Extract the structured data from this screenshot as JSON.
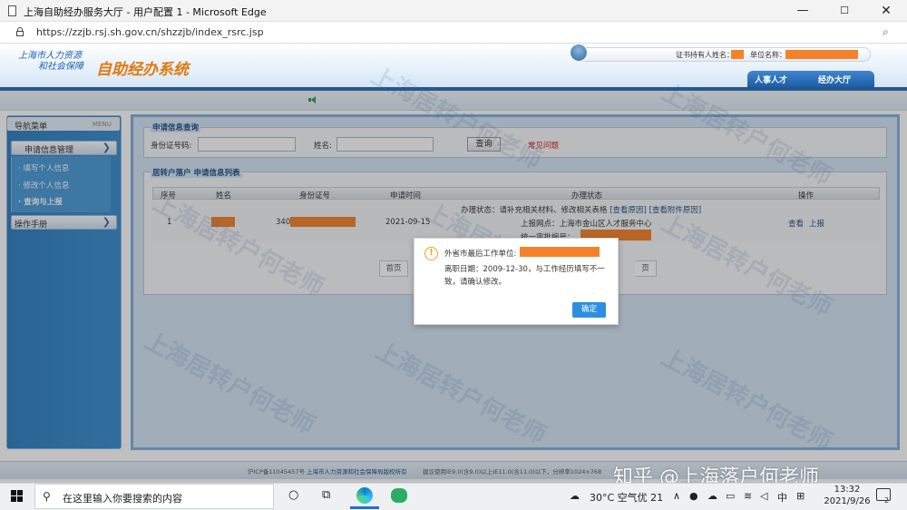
{
  "window": {
    "title": "上海自助经办服务大厅 - 用户配置 1 - Microsoft Edge",
    "min": "—",
    "max": "☐",
    "close": "✕"
  },
  "addressbar": {
    "url": "https://zzjb.rsj.sh.gov.cn/shzzjb/index_rsrc.jsp",
    "zoom": "⌕"
  },
  "header": {
    "org_line1": "上海市人力资源",
    "org_line2": "和社会保障",
    "system_name": "自助经办系统",
    "holder_label": "证书持有人姓名：",
    "unit_label": "单位名称：",
    "nav_hr": "人事人才",
    "nav_hall": "经办大厅"
  },
  "sidebar": {
    "title": "导航菜单",
    "menu_tag": "MENU",
    "group1": "申请信息管理",
    "items": [
      "· 填写个人信息",
      "· 修改个人信息",
      "· 查询与上报"
    ],
    "group2": "操作手册",
    "chevron": "❯"
  },
  "query": {
    "legend": "申请信息查询",
    "id_label": "身份证号码:",
    "name_label": "姓名:",
    "query_button": "查询",
    "faq_link": "常见问题"
  },
  "list": {
    "legend_prefix": "居转户落户",
    "legend_title": "申请信息列表",
    "columns": [
      "序号",
      "姓名",
      "身份证号",
      "申请时间",
      "办理状态",
      "操作"
    ],
    "rows": [
      {
        "index": "1",
        "id_prefix": "340",
        "apply_time": "2021-09-15",
        "status_line1": "办理状态：请补充相关材料、修改相关表格",
        "status_link1": "[查看原因]",
        "status_link2": "[查看附件原因]",
        "status_line2": "上报网点：上海市金山区人才服务中心",
        "status_line3": "统一审批编号：",
        "action_view": "查看",
        "action_report": "上报"
      }
    ],
    "pager_first": "首页",
    "pager_last": "页"
  },
  "modal": {
    "icon": "!",
    "line1": "外省市最后工作单位:",
    "line2": "离职日期：2009-12-30，与工作经历填写不一",
    "line3": "致，请确认修改。",
    "ok_button": "确定"
  },
  "footer": {
    "icp": "沪ICP备11045457号",
    "owner": "上海市人力资源和社会保障局版权所有",
    "advice": "建议使用IE9.0(含9.0)以上IE11.0(含11.0)以下，分辨率1024×768"
  },
  "watermark": "上海居转户何老师",
  "zhihu_mark": "知乎 @上海落户何老师",
  "taskbar": {
    "search_placeholder": "在这里输入你要搜索的内容",
    "weather": "30°C 空气优 21",
    "ime": "中",
    "time": "13:32",
    "date": "2021/9/26",
    "notifications": "2"
  },
  "colors": {
    "accent_blue": "#2a6fb7",
    "redaction": "#f5822a",
    "ok_button": "#2d8fe0",
    "faq_red": "#d42222"
  }
}
